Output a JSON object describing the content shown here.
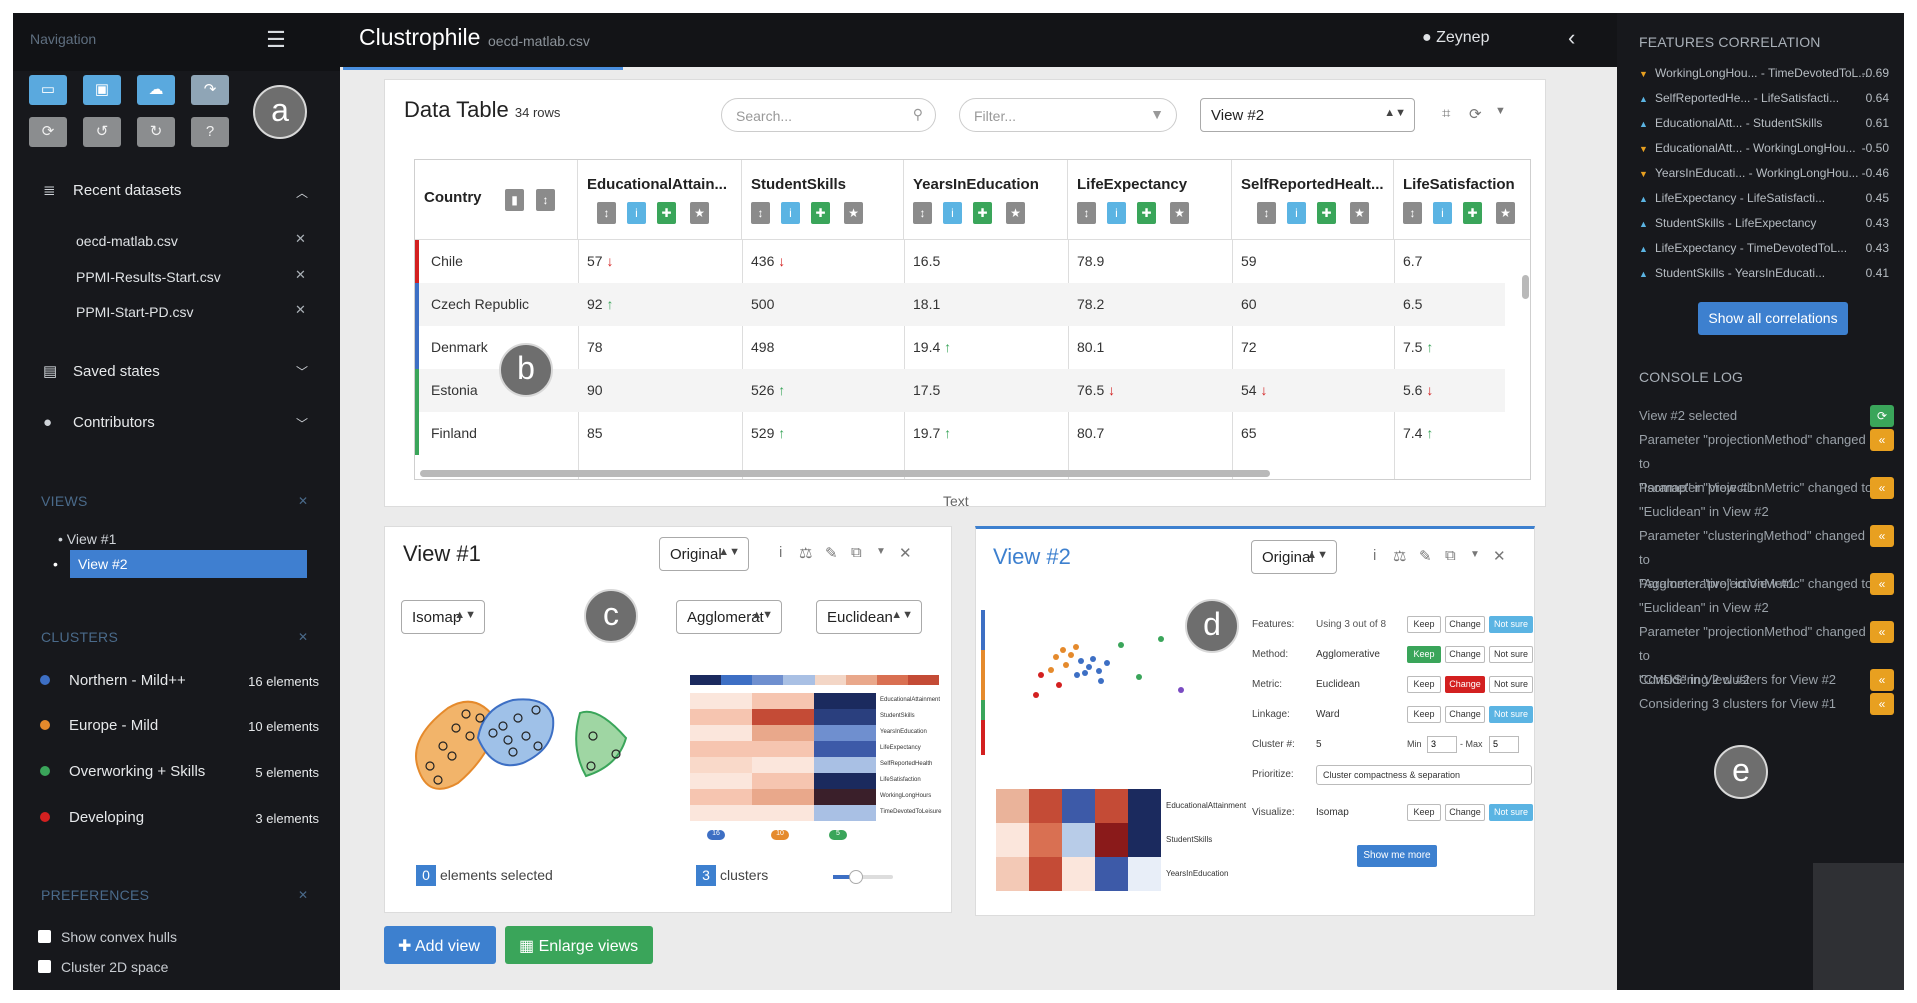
{
  "nav": {
    "title": "Navigation",
    "menu_icon": "hamburger-icon",
    "toolbar": [
      "open-folder-icon",
      "save-icon",
      "cloud-upload-icon",
      "share-icon",
      "refresh-icon",
      "undo-icon",
      "redo-icon",
      "help-icon"
    ],
    "recent_label": "Recent datasets",
    "recent": [
      "oecd-matlab.csv",
      "PPMI-Results-Start.csv",
      "PPMI-Start-PD.csv"
    ],
    "saved_label": "Saved states",
    "contributors_label": "Contributors",
    "views_label": "VIEWS",
    "views": [
      "View #1",
      "View #2"
    ],
    "clusters_label": "CLUSTERS",
    "clusters": [
      {
        "name": "Northern - Mild++",
        "count": "16 elements",
        "color": "#3d6fc4"
      },
      {
        "name": "Europe - Mild",
        "count": "10 elements",
        "color": "#e58a2c"
      },
      {
        "name": "Overworking + Skills",
        "count": "5 elements",
        "color": "#3aa55a"
      },
      {
        "name": "Developing",
        "count": "3 elements",
        "color": "#d32020"
      }
    ],
    "preferences_label": "PREFERENCES",
    "preferences": [
      "Show convex hulls",
      "Cluster 2D space"
    ]
  },
  "labels": {
    "a": "a",
    "b": "b",
    "c": "c",
    "d": "d",
    "e": "e"
  },
  "topbar": {
    "title": "Clustrophile",
    "file": "oecd-matlab.csv",
    "user": "Zeynep"
  },
  "datatable": {
    "title": "Data Table",
    "rows_count": "34 rows",
    "search_placeholder": "Search...",
    "filter_placeholder": "Filter...",
    "view_select": "View #2",
    "columns": [
      "Country",
      "EducationalAttain...",
      "StudentSkills",
      "YearsInEducation",
      "LifeExpectancy",
      "SelfReportedHealt...",
      "LifeSatisfaction"
    ],
    "rows": [
      {
        "cells": [
          "Chile",
          "57",
          "436",
          "16.5",
          "78.9",
          "59",
          "6.7"
        ],
        "trend": [
          "",
          "dn",
          "dn",
          "",
          "",
          "",
          ""
        ],
        "bar": "#d32020"
      },
      {
        "cells": [
          "Czech Republic",
          "92",
          "500",
          "18.1",
          "78.2",
          "60",
          "6.5"
        ],
        "trend": [
          "",
          "up",
          "",
          "",
          "",
          "",
          ""
        ],
        "bar": "#3d6fc4"
      },
      {
        "cells": [
          "Denmark",
          "78",
          "498",
          "19.4",
          "80.1",
          "72",
          "7.5"
        ],
        "trend": [
          "",
          "",
          "",
          "up",
          "",
          "",
          "up"
        ],
        "bar": "#3d6fc4"
      },
      {
        "cells": [
          "Estonia",
          "90",
          "526",
          "17.5",
          "76.5",
          "54",
          "5.6"
        ],
        "trend": [
          "",
          "",
          "up",
          "",
          "dn",
          "dn",
          "dn"
        ],
        "bar": "#3aa55a"
      },
      {
        "cells": [
          "Finland",
          "85",
          "529",
          "19.7",
          "80.7",
          "65",
          "7.4"
        ],
        "trend": [
          "",
          "",
          "up",
          "up",
          "",
          "",
          "up"
        ],
        "bar": "#3aa55a"
      }
    ],
    "caption": "Text"
  },
  "view1": {
    "title": "View #1",
    "mode": "Original",
    "projection": "Isomap",
    "clustering": "Agglomerat",
    "metric": "Euclidean",
    "selected_count": "0",
    "selected_label": "elements selected",
    "clusters_count": "3",
    "clusters_label": "clusters",
    "heat_labels": [
      "EducationalAttainment",
      "StudentSkills",
      "YearsInEducation",
      "LifeExpectancy",
      "SelfReportedHealth",
      "LifeSatisfaction",
      "WorkingLongHours",
      "TimeDevotedToLeisure"
    ],
    "cluster_badges": [
      "16",
      "10",
      "5"
    ]
  },
  "view2": {
    "title": "View #2",
    "mode": "Original",
    "rows": [
      {
        "label": "Features:",
        "value": "Using 3 out of 8"
      },
      {
        "label": "Method:",
        "value": "Agglomerative"
      },
      {
        "label": "Metric:",
        "value": "Euclidean"
      },
      {
        "label": "Linkage:",
        "value": "Ward"
      },
      {
        "label": "Cluster #:",
        "value": "5"
      },
      {
        "label": "Prioritize:",
        "value": "Cluster compactness & separation"
      },
      {
        "label": "Visualize:",
        "value": "Isomap"
      }
    ],
    "keep": "Keep",
    "change": "Change",
    "notsure": "Not sure",
    "min_label": "Min",
    "min_val": "3",
    "max_label": "- Max",
    "max_val": "5",
    "show_more": "Show me more",
    "heat_labels": [
      "EducationalAttainment",
      "StudentSkills",
      "YearsInEducation"
    ]
  },
  "buttons": {
    "add_view": "Add view",
    "enlarge": "Enlarge views"
  },
  "right": {
    "corr_title": "FEATURES CORRELATION",
    "corr": [
      {
        "pair": "WorkingLongHou... - TimeDevotedToL...",
        "value": "-0.69",
        "dir": "down"
      },
      {
        "pair": "SelfReportedHe... - LifeSatisfacti...",
        "value": "0.64",
        "dir": "up"
      },
      {
        "pair": "EducationalAtt... - StudentSkills",
        "value": "0.61",
        "dir": "up"
      },
      {
        "pair": "EducationalAtt... - WorkingLongHou...",
        "value": "-0.50",
        "dir": "down"
      },
      {
        "pair": "YearsInEducati... - WorkingLongHou...",
        "value": "-0.46",
        "dir": "down"
      },
      {
        "pair": "LifeExpectancy - LifeSatisfacti...",
        "value": "0.45",
        "dir": "up"
      },
      {
        "pair": "StudentSkills - LifeExpectancy",
        "value": "0.43",
        "dir": "up"
      },
      {
        "pair": "LifeExpectancy - TimeDevotedToL...",
        "value": "0.43",
        "dir": "up"
      },
      {
        "pair": "StudentSkills - YearsInEducati...",
        "value": "0.41",
        "dir": "up"
      }
    ],
    "show_all": "Show all correlations",
    "console_title": "CONSOLE LOG",
    "log": [
      {
        "lines": [
          "View #2 selected"
        ],
        "icon": "refresh-icon",
        "color": "#3aa55a"
      },
      {
        "lines": [
          "Parameter \"projectionMethod\" changed to",
          "\"Isomap\" in View #1"
        ],
        "icon": "rewind-icon",
        "color": "#e8a020"
      },
      {
        "lines": [
          "Parameter \"projectionMetric\" changed to",
          "\"Euclidean\" in View #2"
        ],
        "icon": "rewind-icon",
        "color": "#e8a020"
      },
      {
        "lines": [
          "Parameter \"clusteringMethod\" changed to",
          "\"Agglomerative\" in View #1"
        ],
        "icon": "rewind-icon",
        "color": "#e8a020"
      },
      {
        "lines": [
          "Parameter \"projectionMetric\" changed to",
          "\"Euclidean\" in View #2"
        ],
        "icon": "rewind-icon",
        "color": "#e8a020"
      },
      {
        "lines": [
          "Parameter \"projectionMethod\" changed to",
          "\"CMDS\" in View #2"
        ],
        "icon": "rewind-icon",
        "color": "#e8a020"
      },
      {
        "lines": [
          "Considering 2 clusters for View #2"
        ],
        "icon": "rewind-icon",
        "color": "#e8a020"
      },
      {
        "lines": [
          "Considering 3 clusters for View #1"
        ],
        "icon": "rewind-icon",
        "color": "#e8a020"
      }
    ]
  }
}
